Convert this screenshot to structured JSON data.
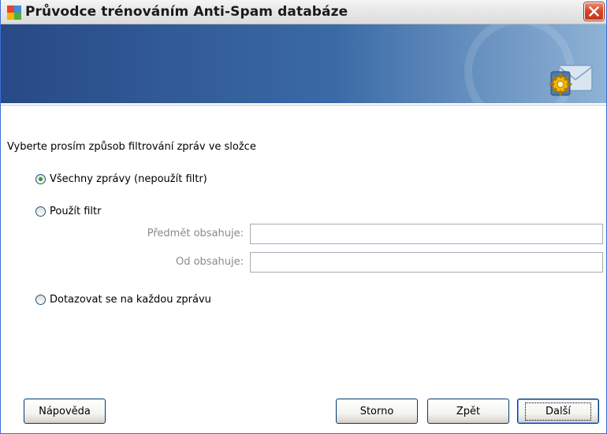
{
  "window": {
    "title": "Průvodce trénováním Anti-Spam databáze",
    "app_icon": "avg-icon",
    "close_icon": "close-icon"
  },
  "banner": {
    "icon": "mail-gear-icon"
  },
  "content": {
    "instruction": "Vyberte prosím způsob filtrování zpráv ve složce",
    "options": [
      {
        "label": "Všechny zprávy (nepoužít filtr)",
        "checked": true
      },
      {
        "label": "Použít filtr",
        "checked": false
      },
      {
        "label": "Dotazovat se na každou zprávu",
        "checked": false
      }
    ],
    "filter": {
      "subject_label": "Předmět obsahuje:",
      "subject_value": "",
      "from_label": "Od obsahuje:",
      "from_value": ""
    }
  },
  "buttons": {
    "help": "Nápověda",
    "cancel": "Storno",
    "back": "Zpět",
    "next": "Další"
  },
  "colors": {
    "banner_start": "#284a86",
    "banner_end": "#8fb3d6",
    "radio_dot": "#21a121",
    "close_button": "#d6462a"
  }
}
